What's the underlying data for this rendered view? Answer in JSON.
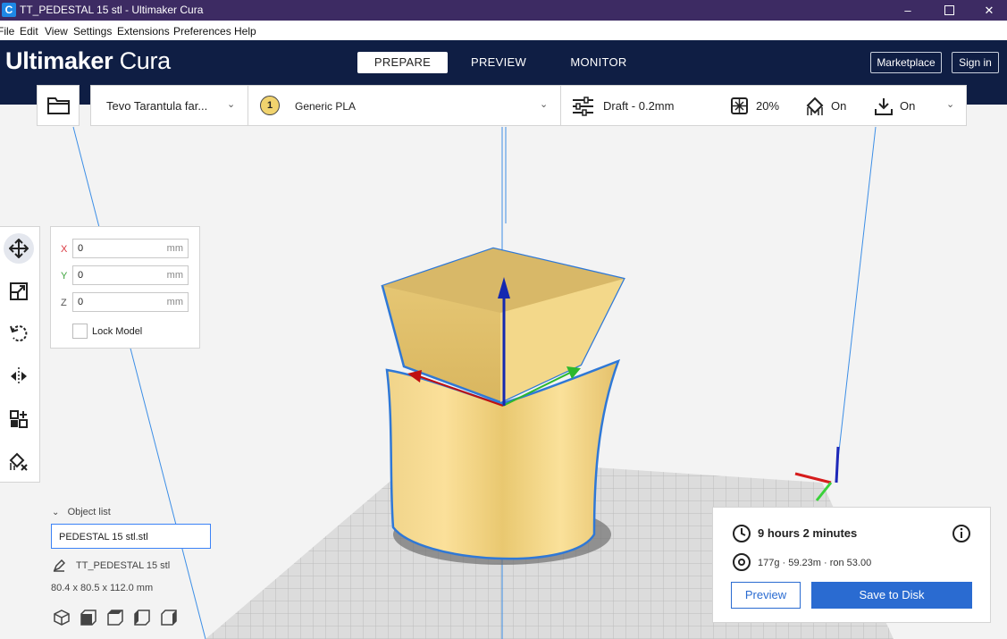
{
  "window": {
    "title": "TT_PEDESTAL 15 stl - Ultimaker Cura",
    "app_icon_glyph": "C",
    "controls": [
      "minimize-icon",
      "maximize-icon",
      "close-icon"
    ]
  },
  "menu": {
    "items": [
      "File",
      "Edit",
      "View",
      "Settings",
      "Extensions",
      "Preferences",
      "Help"
    ]
  },
  "header": {
    "logo_bold": "Ultimaker",
    "logo_light": "Cura",
    "tabs": [
      {
        "label": "PREPARE",
        "active": true
      },
      {
        "label": "PREVIEW",
        "active": false
      },
      {
        "label": "MONITOR",
        "active": false
      }
    ],
    "marketplace_label": "Marketplace",
    "signin_label": "Sign in",
    "colors": {
      "header_bg": "#0f1e44",
      "titlebar_bg": "#3d2b63",
      "accent": "#2a6bd1"
    }
  },
  "toolbar": {
    "printer": "Tevo Tarantula far...",
    "extruder_number": "1",
    "material": "Generic PLA",
    "profile": "Draft - 0.2mm",
    "infill": "20%",
    "support": "On",
    "adhesion": "On"
  },
  "tools": [
    "move-icon",
    "scale-icon",
    "rotate-icon",
    "mirror-icon",
    "per-model-settings-icon",
    "support-blocker-icon"
  ],
  "move_panel": {
    "fields": [
      {
        "axis": "X",
        "value": "0",
        "unit": "mm",
        "color": "#d9363e"
      },
      {
        "axis": "Y",
        "value": "0",
        "unit": "mm",
        "color": "#3ca33c"
      },
      {
        "axis": "Z",
        "value": "0",
        "unit": "mm",
        "color": "#555555"
      }
    ],
    "lock_label": "Lock Model",
    "lock_checked": false
  },
  "object_list": {
    "header": "Object list",
    "selected": "PEDESTAL 15 stl.stl",
    "name": "TT_PEDESTAL 15 stl",
    "dimensions": "80.4 x 80.5 x 112.0 mm",
    "view_buttons": [
      "3d-view-icon",
      "front-view-icon",
      "top-view-icon",
      "left-view-icon",
      "right-view-icon"
    ]
  },
  "print_panel": {
    "time": "9 hours 2 minutes",
    "material_usage": "177g · 59.23m · ron 53.00",
    "preview_label": "Preview",
    "save_label": "Save to Disk"
  }
}
